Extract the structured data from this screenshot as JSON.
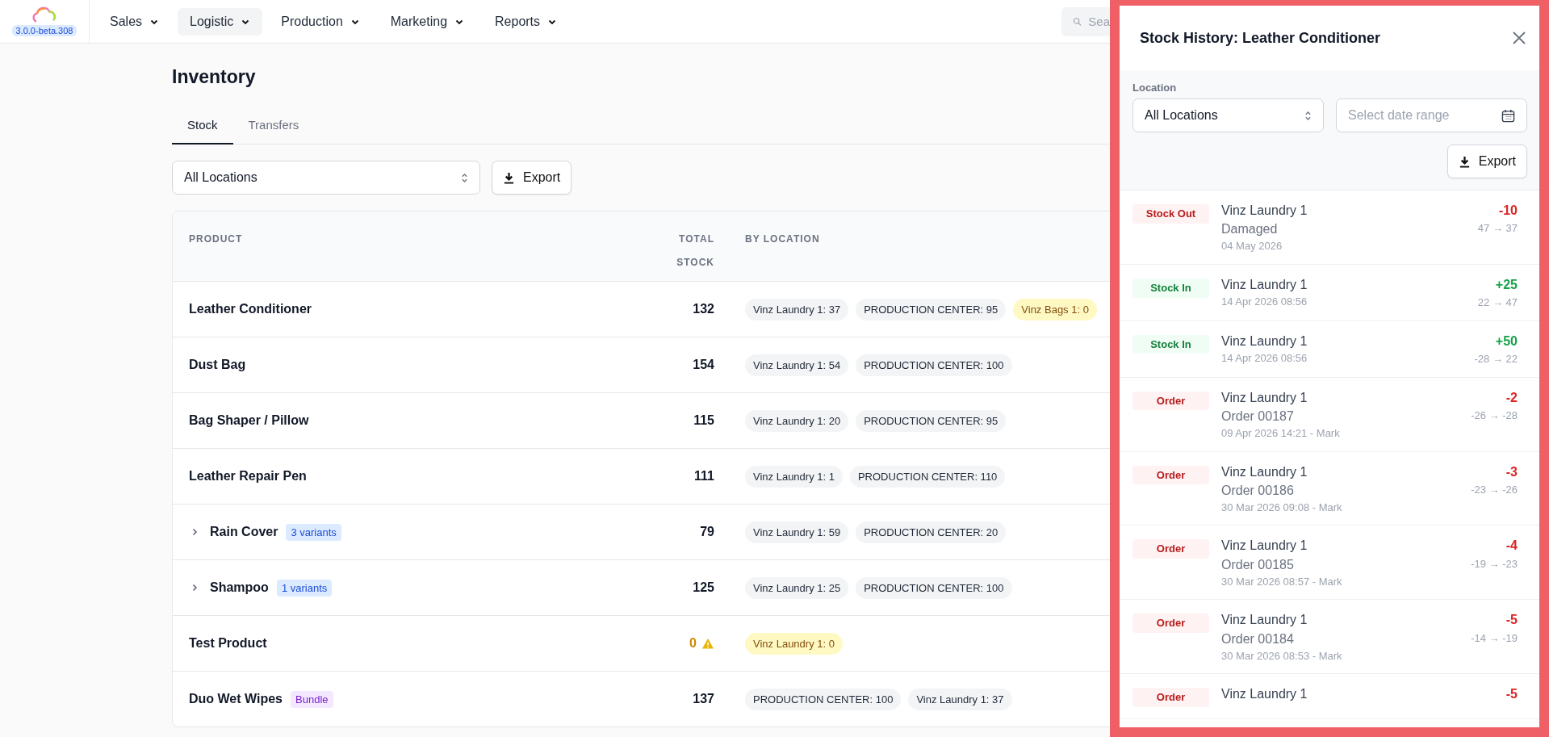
{
  "app": {
    "version": "3.0.0-beta.308"
  },
  "nav": [
    {
      "label": "Sales",
      "selected": false
    },
    {
      "label": "Logistic",
      "selected": true
    },
    {
      "label": "Production",
      "selected": false
    },
    {
      "label": "Marketing",
      "selected": false
    },
    {
      "label": "Reports",
      "selected": false
    }
  ],
  "search": {
    "placeholder": "Sea"
  },
  "page": {
    "title": "Inventory"
  },
  "tabs": [
    {
      "label": "Stock",
      "selected": true
    },
    {
      "label": "Transfers",
      "selected": false
    }
  ],
  "filter": {
    "location": "All Locations",
    "export": "Export"
  },
  "table": {
    "columns": [
      "PRODUCT",
      "TOTAL STOCK",
      "BY LOCATION"
    ],
    "rows": [
      {
        "name": "Leather Conditioner",
        "total": "132",
        "warning": false,
        "locations": [
          {
            "label": "Vinz Laundry 1: 37",
            "warning": false
          },
          {
            "label": "PRODUCTION CENTER: 95",
            "warning": false
          },
          {
            "label": "Vinz Bags 1: 0",
            "warning": true
          }
        ]
      },
      {
        "name": "Dust Bag",
        "total": "154",
        "warning": false,
        "locations": [
          {
            "label": "Vinz Laundry 1: 54",
            "warning": false
          },
          {
            "label": "PRODUCTION CENTER: 100",
            "warning": false
          }
        ]
      },
      {
        "name": "Bag Shaper / Pillow",
        "total": "115",
        "warning": false,
        "locations": [
          {
            "label": "Vinz Laundry 1: 20",
            "warning": false
          },
          {
            "label": "PRODUCTION CENTER: 95",
            "warning": false
          }
        ]
      },
      {
        "name": "Leather Repair Pen",
        "total": "111",
        "warning": false,
        "locations": [
          {
            "label": "Vinz Laundry 1: 1",
            "warning": false
          },
          {
            "label": "PRODUCTION CENTER: 110",
            "warning": false
          }
        ]
      },
      {
        "name": "Rain Cover",
        "expanded": false,
        "tag": {
          "label": "3 variants",
          "kind": "variants"
        },
        "total": "79",
        "warning": false,
        "locations": [
          {
            "label": "Vinz Laundry 1: 59",
            "warning": false
          },
          {
            "label": "PRODUCTION CENTER: 20",
            "warning": false
          }
        ]
      },
      {
        "name": "Shampoo",
        "expanded": false,
        "tag": {
          "label": "1 variants",
          "kind": "variants"
        },
        "total": "125",
        "warning": false,
        "locations": [
          {
            "label": "Vinz Laundry 1: 25",
            "warning": false
          },
          {
            "label": "PRODUCTION CENTER: 100",
            "warning": false
          }
        ]
      },
      {
        "name": "Test Product",
        "total": "0",
        "warning": true,
        "locations": [
          {
            "label": "Vinz Laundry 1: 0",
            "warning": true
          }
        ]
      },
      {
        "name": "Duo Wet Wipes",
        "tag": {
          "label": "Bundle",
          "kind": "bundle"
        },
        "total": "137",
        "warning": false,
        "locations": [
          {
            "label": "PRODUCTION CENTER: 100",
            "warning": false
          },
          {
            "label": "Vinz Laundry 1: 37",
            "warning": false
          }
        ]
      }
    ]
  },
  "drawer": {
    "title": "Stock History: Leather Conditioner",
    "location_label": "Location",
    "location": "All Locations",
    "date_placeholder": "Select date range",
    "export": "Export",
    "entries": [
      {
        "kind": "stock_out",
        "badge": "Stock Out",
        "location": "Vinz Laundry 1",
        "detail": "Damaged",
        "date": "04 May 2026",
        "amount": "-10",
        "change": "47 → 37"
      },
      {
        "kind": "stock_in",
        "badge": "Stock In",
        "location": "Vinz Laundry 1",
        "date": "14 Apr 2026 08:56",
        "amount": "+25",
        "change": "22 → 47"
      },
      {
        "kind": "stock_in",
        "badge": "Stock In",
        "location": "Vinz Laundry 1",
        "date": "14 Apr 2026 08:56",
        "amount": "+50",
        "change": "-28 → 22"
      },
      {
        "kind": "order",
        "badge": "Order",
        "location": "Vinz Laundry 1",
        "detail": "Order 00187",
        "date": "09 Apr 2026 14:21 - Mark",
        "amount": "-2",
        "change": "-26 → -28"
      },
      {
        "kind": "order",
        "badge": "Order",
        "location": "Vinz Laundry 1",
        "detail": "Order 00186",
        "date": "30 Mar 2026 09:08 - Mark",
        "amount": "-3",
        "change": "-23 → -26"
      },
      {
        "kind": "order",
        "badge": "Order",
        "location": "Vinz Laundry 1",
        "detail": "Order 00185",
        "date": "30 Mar 2026 08:57 - Mark",
        "amount": "-4",
        "change": "-19 → -23"
      },
      {
        "kind": "order",
        "badge": "Order",
        "location": "Vinz Laundry 1",
        "detail": "Order 00184",
        "date": "30 Mar 2026 08:53 - Mark",
        "amount": "-5",
        "change": "-14 → -19"
      },
      {
        "kind": "order",
        "badge": "Order",
        "location": "Vinz Laundry 1",
        "amount": "-5"
      }
    ]
  }
}
